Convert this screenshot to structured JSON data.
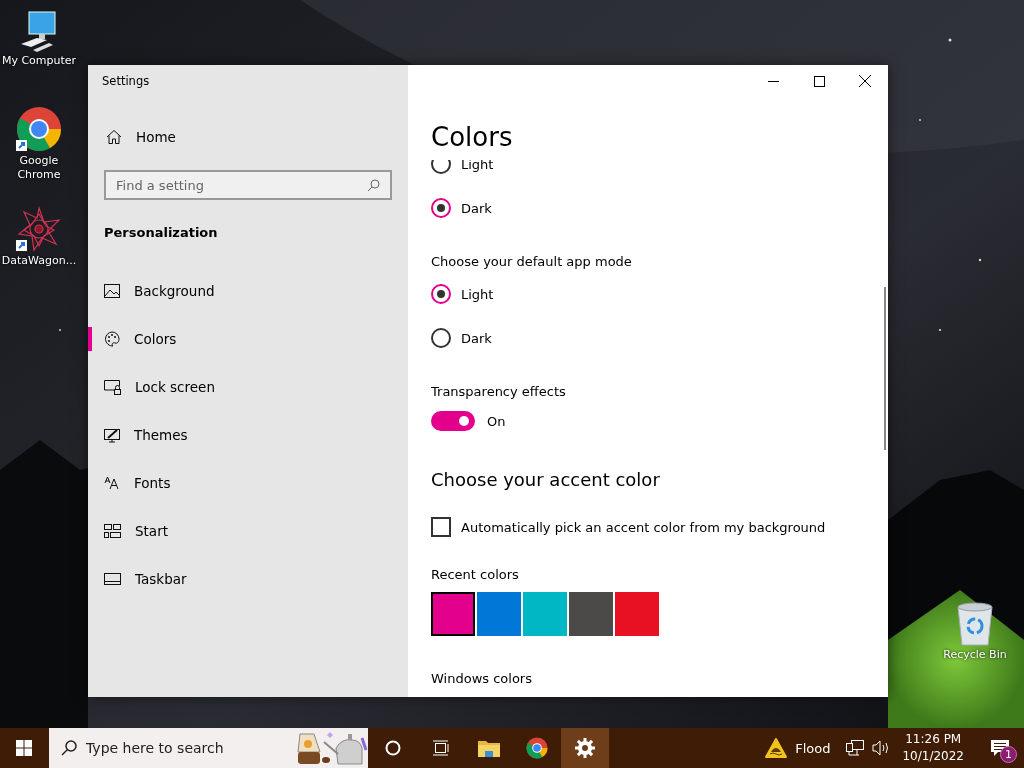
{
  "desktop_icons": [
    {
      "kind": "computer",
      "label": "My Computer"
    },
    {
      "kind": "chrome",
      "label": "Google Chrome"
    },
    {
      "kind": "app",
      "label": "DataWagon..."
    },
    {
      "kind": "recycle",
      "label": "Recycle Bin"
    }
  ],
  "window": {
    "title": "Settings"
  },
  "sidebar": {
    "home": "Home",
    "search": {
      "placeholder": "Find a setting"
    },
    "section": "Personalization",
    "items": [
      {
        "kind": "background",
        "label": "Background",
        "selected": false
      },
      {
        "kind": "colors",
        "label": "Colors",
        "selected": true
      },
      {
        "kind": "lock",
        "label": "Lock screen",
        "selected": false
      },
      {
        "kind": "themes",
        "label": "Themes",
        "selected": false
      },
      {
        "kind": "fonts",
        "label": "Fonts",
        "selected": false
      },
      {
        "kind": "start",
        "label": "Start",
        "selected": false
      },
      {
        "kind": "taskbar",
        "label": "Taskbar",
        "selected": false
      }
    ]
  },
  "content": {
    "title": "Colors",
    "windows_mode": [
      {
        "label": "Light",
        "selected": false
      },
      {
        "label": "Dark",
        "selected": true
      }
    ],
    "app_mode": {
      "label": "Choose your default app mode",
      "options": [
        {
          "label": "Light",
          "selected": true
        },
        {
          "label": "Dark",
          "selected": false
        }
      ]
    },
    "transparency": {
      "label": "Transparency effects",
      "on": true,
      "state": "On"
    },
    "accent": {
      "heading": "Choose your accent color",
      "auto_pick": {
        "label": "Automatically pick an accent color from my background",
        "checked": false
      },
      "recent_label": "Recent colors",
      "recent_colors": [
        {
          "color": "#e3008c",
          "selected": true
        },
        {
          "color": "#0078d7",
          "selected": false
        },
        {
          "color": "#00b7c3",
          "selected": false
        },
        {
          "color": "#4c4a48",
          "selected": false
        },
        {
          "color": "#e81123",
          "selected": false
        }
      ],
      "windows_colors_label": "Windows colors"
    }
  },
  "taskbar": {
    "search": {
      "placeholder": "Type here to search"
    },
    "apps": [
      {
        "kind": "cortana",
        "selected": false
      },
      {
        "kind": "taskview",
        "selected": false
      },
      {
        "kind": "folder",
        "selected": false
      },
      {
        "kind": "chrome",
        "selected": false
      },
      {
        "kind": "settings",
        "selected": true
      }
    ],
    "weather": "Flood",
    "time": "11:26 PM",
    "date": "10/1/2022",
    "notification_count": "1"
  }
}
